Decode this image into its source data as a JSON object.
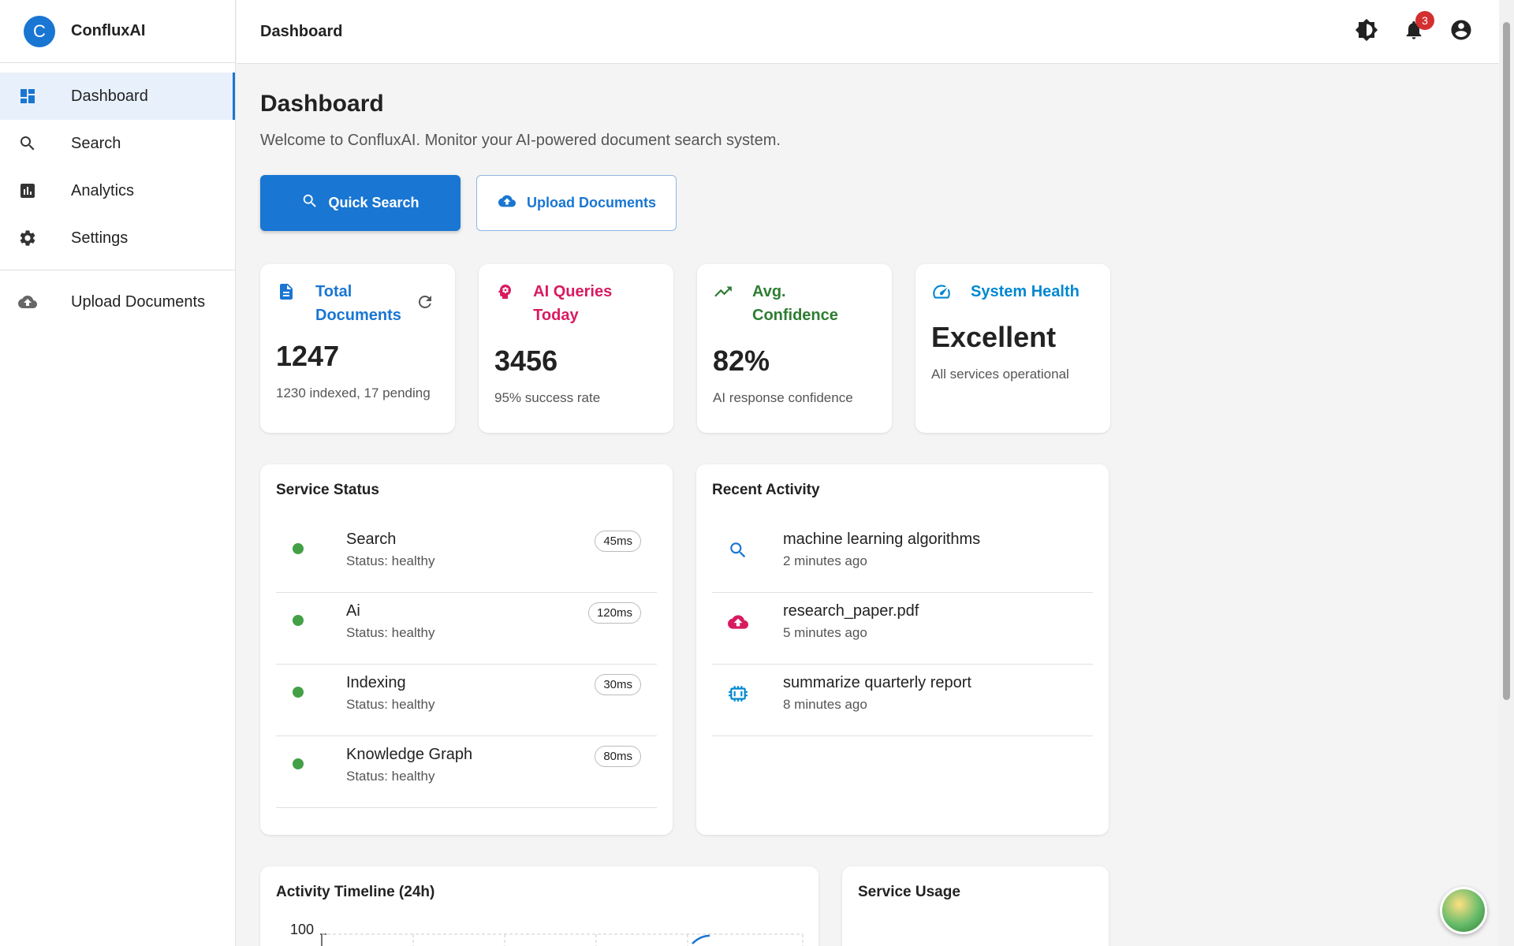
{
  "app": {
    "logo_letter": "C",
    "name": "ConfluxAI"
  },
  "sidebar": {
    "items": [
      {
        "label": "Dashboard",
        "icon": "dashboard-icon"
      },
      {
        "label": "Search",
        "icon": "search-icon"
      },
      {
        "label": "Analytics",
        "icon": "analytics-icon"
      },
      {
        "label": "Settings",
        "icon": "gear-icon"
      }
    ],
    "upload": {
      "label": "Upload Documents",
      "icon": "cloud-upload-icon"
    }
  },
  "topbar": {
    "title": "Dashboard",
    "notification_count": "3"
  },
  "page": {
    "title": "Dashboard",
    "subtitle": "Welcome to ConfluxAI. Monitor your AI-powered document search system."
  },
  "actions": {
    "quick_search": "Quick Search",
    "upload_documents": "Upload Documents"
  },
  "stats": [
    {
      "label": "Total Documents",
      "value": "1247",
      "sub": "1230 indexed, 17 pending",
      "color": "#1976d2",
      "icon": "document-icon"
    },
    {
      "label": "AI Queries Today",
      "value": "3456",
      "sub": "95% success rate",
      "color": "#d81b60",
      "icon": "brain-icon"
    },
    {
      "label": "Avg. Confidence",
      "value": "82%",
      "sub": "AI response confidence",
      "color": "#2e7d32",
      "icon": "trending-up-icon"
    },
    {
      "label": "System Health",
      "value": "Excellent",
      "sub": "All services operational",
      "color": "#0288d1",
      "icon": "speedometer-icon"
    }
  ],
  "service_status": {
    "title": "Service Status",
    "items": [
      {
        "name": "Search",
        "status": "Status: healthy",
        "latency": "45ms"
      },
      {
        "name": "Ai",
        "status": "Status: healthy",
        "latency": "120ms"
      },
      {
        "name": "Indexing",
        "status": "Status: healthy",
        "latency": "30ms"
      },
      {
        "name": "Knowledge Graph",
        "status": "Status: healthy",
        "latency": "80ms"
      }
    ]
  },
  "recent_activity": {
    "title": "Recent Activity",
    "items": [
      {
        "text": "machine learning algorithms",
        "time": "2 minutes ago",
        "icon": "search-icon"
      },
      {
        "text": "research_paper.pdf",
        "time": "5 minutes ago",
        "icon": "cloud-upload-icon"
      },
      {
        "text": "summarize quarterly report",
        "time": "8 minutes ago",
        "icon": "chip-icon"
      }
    ]
  },
  "activity_timeline": {
    "title": "Activity Timeline (24h)",
    "y_tick_top": "100"
  },
  "service_usage": {
    "title": "Service Usage"
  },
  "colors": {
    "primary": "#1976d2",
    "healthy": "#43a047",
    "badge": "#d32f2f"
  }
}
